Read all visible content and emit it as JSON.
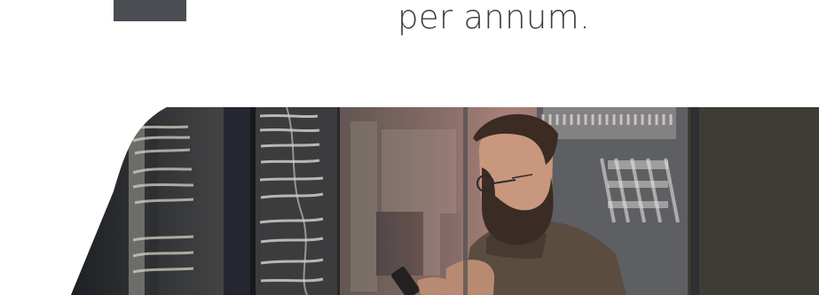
{
  "stat": {
    "text": "per annum."
  },
  "hero": {
    "image": "photo-man-server-room",
    "colors": {
      "dark_panel": "#3e3c35",
      "rack_dark": "#2a2c31",
      "shirt": "#5a4a3c",
      "hair": "#3a2a20",
      "skin": "#c9977e"
    }
  }
}
